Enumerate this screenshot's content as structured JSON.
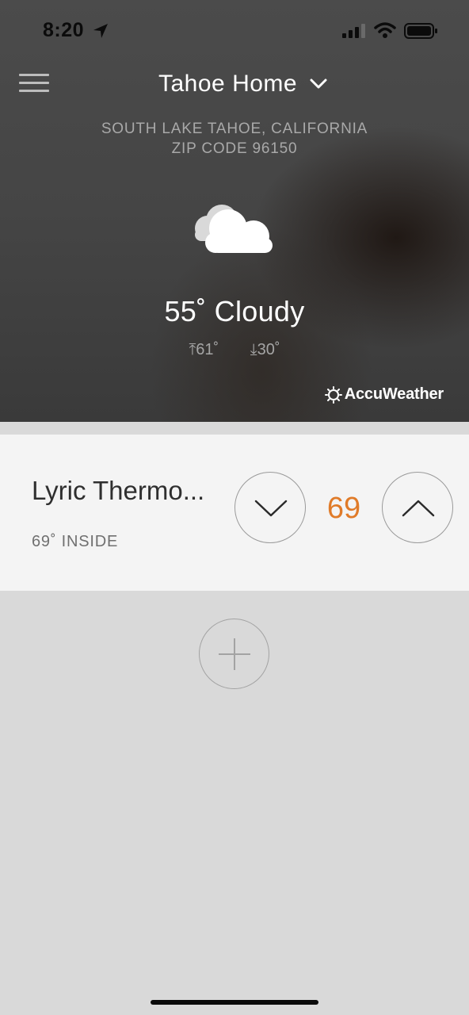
{
  "status_bar": {
    "time": "8:20"
  },
  "header": {
    "home_name": "Tahoe Home",
    "location_line1": "SOUTH LAKE TAHOE, CALIFORNIA",
    "location_line2": "ZIP CODE 96150"
  },
  "weather": {
    "icon": "cloud-icon",
    "current": "55˚ Cloudy",
    "high": "⤒61˚",
    "low": "⤓30˚",
    "provider": "AccuWeather"
  },
  "thermostat": {
    "name": "Lyric Thermo...",
    "inside": "69˚ INSIDE",
    "setpoint": "69",
    "setpoint_color": "#e07b29"
  },
  "icons": {
    "menu": "hamburger-menu-icon",
    "dropdown": "chevron-down-icon",
    "decrease": "chevron-down-icon",
    "increase": "chevron-up-icon",
    "add": "plus-icon"
  }
}
